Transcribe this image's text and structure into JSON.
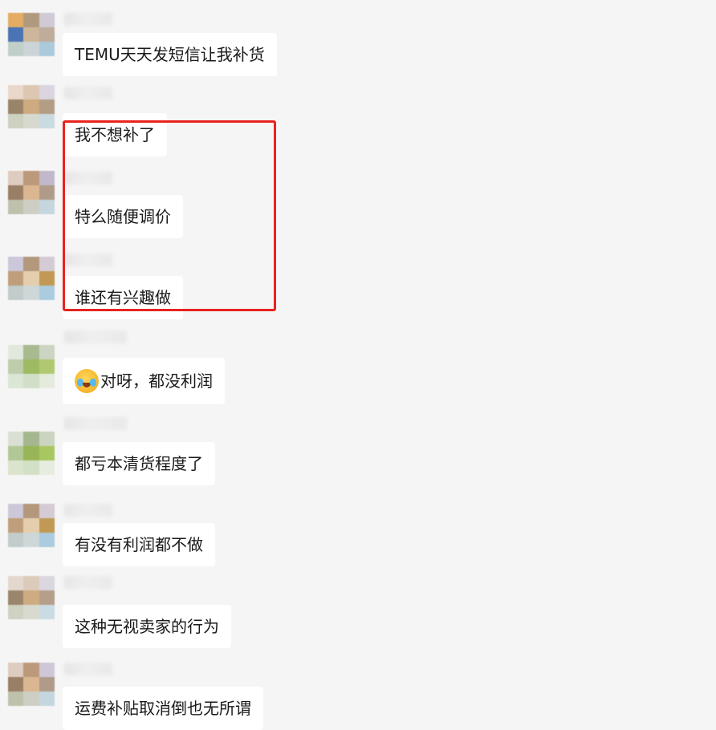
{
  "messages": [
    {
      "text": "TEMU天天发短信让我补货"
    },
    {
      "text": "我不想补了"
    },
    {
      "text": "特么随便调价"
    },
    {
      "text": "谁还有兴趣做"
    },
    {
      "text": "对呀，都没利润",
      "emoji": "laughing-crying-emoji-icon"
    },
    {
      "text": "都亏本清货程度了"
    },
    {
      "text": "有没有利润都不做"
    },
    {
      "text": "这种无视卖家的行为"
    },
    {
      "text": "运费补贴取消倒也无所谓"
    }
  ],
  "colors": {
    "background": "#f5f5f5",
    "bubble": "#ffffff",
    "text": "#1a1a1a",
    "highlight_border": "#e8231e"
  }
}
